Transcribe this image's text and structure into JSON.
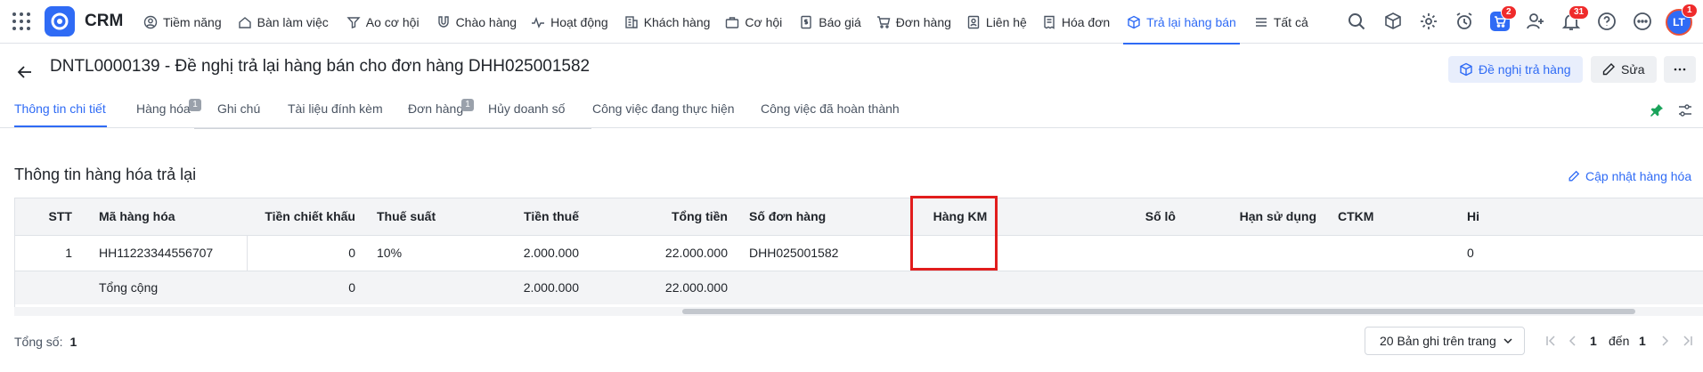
{
  "app": {
    "name": "CRM"
  },
  "nav": [
    {
      "label": "Tiềm năng",
      "icon": "person-icon"
    },
    {
      "label": "Bàn làm việc",
      "icon": "home-icon"
    },
    {
      "label": "Ao cơ hội",
      "icon": "funnel-icon"
    },
    {
      "label": "Chào hàng",
      "icon": "magnet-icon"
    },
    {
      "label": "Hoạt động",
      "icon": "activity-icon"
    },
    {
      "label": "Khách hàng",
      "icon": "building-icon"
    },
    {
      "label": "Cơ hội",
      "icon": "briefcase-icon"
    },
    {
      "label": "Báo giá",
      "icon": "document-dollar-icon"
    },
    {
      "label": "Đơn hàng",
      "icon": "cart-icon"
    },
    {
      "label": "Liên hệ",
      "icon": "contact-icon"
    },
    {
      "label": "Hóa đơn",
      "icon": "invoice-icon"
    },
    {
      "label": "Trả lại hàng bán",
      "icon": "return-box-icon",
      "active": true
    },
    {
      "label": "Tất cả",
      "icon": "menu-icon"
    }
  ],
  "header_badges": {
    "cart": "2",
    "notifications": "31",
    "avatar": "1"
  },
  "avatar_initials": "LT",
  "page": {
    "title": "DNTL0000139 - Đề nghị trả lại hàng bán cho đơn hàng DHH025001582",
    "actions": {
      "request_return": "Đề nghị trả hàng",
      "edit": "Sửa"
    }
  },
  "tabs": [
    {
      "label": "Thông tin chi tiết",
      "active": true
    },
    {
      "label": "Hàng hóa",
      "badge": "1"
    },
    {
      "label": "Ghi chú"
    },
    {
      "label": "Tài liệu đính kèm"
    },
    {
      "label": "Đơn hàng",
      "badge": "1"
    },
    {
      "label": "Hủy doanh số"
    },
    {
      "label": "Công việc đang thực hiện"
    },
    {
      "label": "Công việc đã hoàn thành"
    }
  ],
  "section": {
    "title": "Thông tin hàng hóa trả lại",
    "update_link": "Cập nhật hàng hóa"
  },
  "table": {
    "columns": [
      "STT",
      "Mã hàng hóa",
      "Tiền chiết khấu",
      "Thuế suất",
      "Tiền thuế",
      "Tổng tiền",
      "Số đơn hàng",
      "Hàng KM",
      "Số lô",
      "Hạn sử dụng",
      "CTKM",
      "Hi"
    ],
    "rows": [
      [
        "1",
        "HH11223344556707",
        "0",
        "10%",
        "2.000.000",
        "22.000.000",
        "DHH025001582",
        "",
        "",
        "",
        "",
        "0"
      ]
    ],
    "total": {
      "label": "Tổng cộng",
      "discount": "0",
      "tax": "2.000.000",
      "amount": "22.000.000"
    }
  },
  "footer": {
    "total_label": "Tổng số:",
    "total_value": "1",
    "page_size": "20 Bản ghi trên trang",
    "page_from": "1",
    "page_to_label": "đến",
    "page_to": "1"
  },
  "colors": {
    "accent": "#2f6bf5",
    "badge": "#ef2b2b",
    "highlight": "#e11d1d"
  }
}
